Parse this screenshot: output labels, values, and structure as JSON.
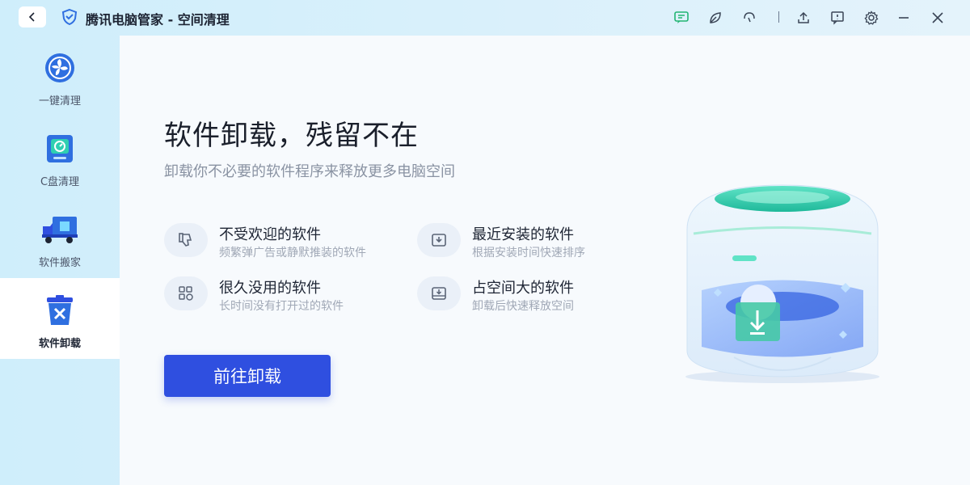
{
  "window": {
    "title": "腾讯电脑管家 - 空间清理",
    "back_icon": "chevron-left-icon",
    "toolbar_icons": [
      "message-icon",
      "leaf-icon",
      "headset-icon",
      "upload-icon",
      "feedback-icon",
      "gear-icon",
      "minimize-icon",
      "close-icon"
    ]
  },
  "sidebar": {
    "items": [
      {
        "label": "一键清理",
        "icon": "fan-icon"
      },
      {
        "label": "C盘清理",
        "icon": "disk-icon"
      },
      {
        "label": "软件搬家",
        "icon": "truck-icon"
      },
      {
        "label": "软件卸载",
        "icon": "trash-icon",
        "active": true
      }
    ]
  },
  "main": {
    "headline": "软件卸载，残留不在",
    "subhead": "卸载你不必要的软件程序来释放更多电脑空间",
    "features": [
      {
        "title": "不受欢迎的软件",
        "desc": "频繁弹广告或静默推装的软件",
        "icon": "thumbs-down-icon"
      },
      {
        "title": "最近安装的软件",
        "desc": "根据安装时间快速排序",
        "icon": "inbox-download-icon"
      },
      {
        "title": "很久没用的软件",
        "desc": "长时间没有打开过的软件",
        "icon": "apps-clock-icon"
      },
      {
        "title": "占空间大的软件",
        "desc": "卸载后快速释放空间",
        "icon": "drive-download-icon"
      }
    ],
    "cta_label": "前往卸载"
  },
  "colors": {
    "accent": "#2f4fe0",
    "teal": "#2fcfb1",
    "sidebar_bg": "#cfeefb"
  }
}
